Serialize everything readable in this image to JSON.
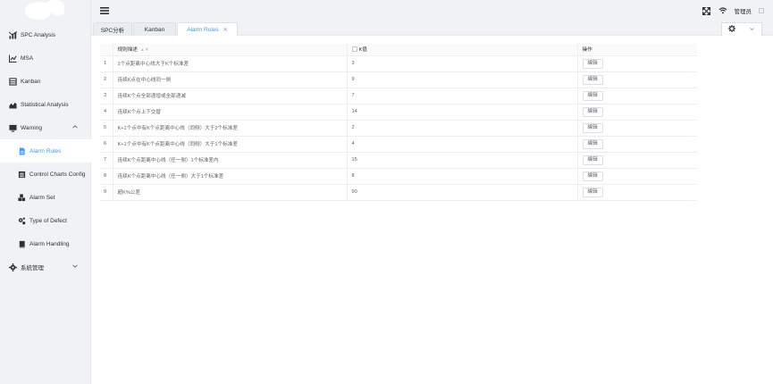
{
  "app": {
    "user_name": "管理员"
  },
  "sidebar": {
    "items": [
      {
        "label": "SPC Analysis",
        "icon": "chart-bar-icon",
        "level": 1
      },
      {
        "label": "MSA",
        "icon": "chart-line-icon",
        "level": 1
      },
      {
        "label": "Kanban",
        "icon": "grid-icon",
        "level": 1
      },
      {
        "label": "Statistical Analysis",
        "icon": "chart-area-icon",
        "level": 1
      },
      {
        "label": "Warning",
        "icon": "monitor-icon",
        "level": 1,
        "expanded": true
      },
      {
        "label": "Alarm Rules",
        "icon": "document-icon",
        "level": 2,
        "active": true
      },
      {
        "label": "Control Charts Config",
        "icon": "list-icon",
        "level": 2
      },
      {
        "label": "Alarm Set",
        "icon": "cubes-icon",
        "level": 2
      },
      {
        "label": "Type of Defect",
        "icon": "gears-icon",
        "level": 2
      },
      {
        "label": "Alarm Handling",
        "icon": "book-icon",
        "level": 2
      },
      {
        "label": "系統管理",
        "icon": "gear-icon",
        "level": 1,
        "expanded": false
      }
    ]
  },
  "tabs": [
    {
      "label": "SPC分析",
      "active": false
    },
    {
      "label": "Kanban",
      "active": false
    },
    {
      "label": "Alarm Rules",
      "active": true,
      "closable": true
    }
  ],
  "table": {
    "headers": {
      "index": "",
      "description": "规则描述",
      "k_value": "K值",
      "action": "操作"
    },
    "edit_label": "编辑",
    "rows": [
      {
        "index": "1",
        "description": "1个点距离中心线大于K个标准差",
        "k": "3"
      },
      {
        "index": "2",
        "description": "连续K点在中心线同一侧",
        "k": "9"
      },
      {
        "index": "3",
        "description": "连续K个点全部递增或全部递减",
        "k": "7"
      },
      {
        "index": "4",
        "description": "连续K个点上下交替",
        "k": "14"
      },
      {
        "index": "5",
        "description": "K+1个点中有K个点距离中心线（同侧）大于2个标准差",
        "k": "2"
      },
      {
        "index": "6",
        "description": "K+1个点中有K个点距离中心线（同侧）大于1个标准差",
        "k": "4"
      },
      {
        "index": "7",
        "description": "连续K个点距离中心线（任一侧）1个标准差内",
        "k": "15"
      },
      {
        "index": "8",
        "description": "连续K个点距离中心线（任一侧）大于1个标准差",
        "k": "8"
      },
      {
        "index": "9",
        "description": "超K%公差",
        "k": "90"
      }
    ]
  }
}
